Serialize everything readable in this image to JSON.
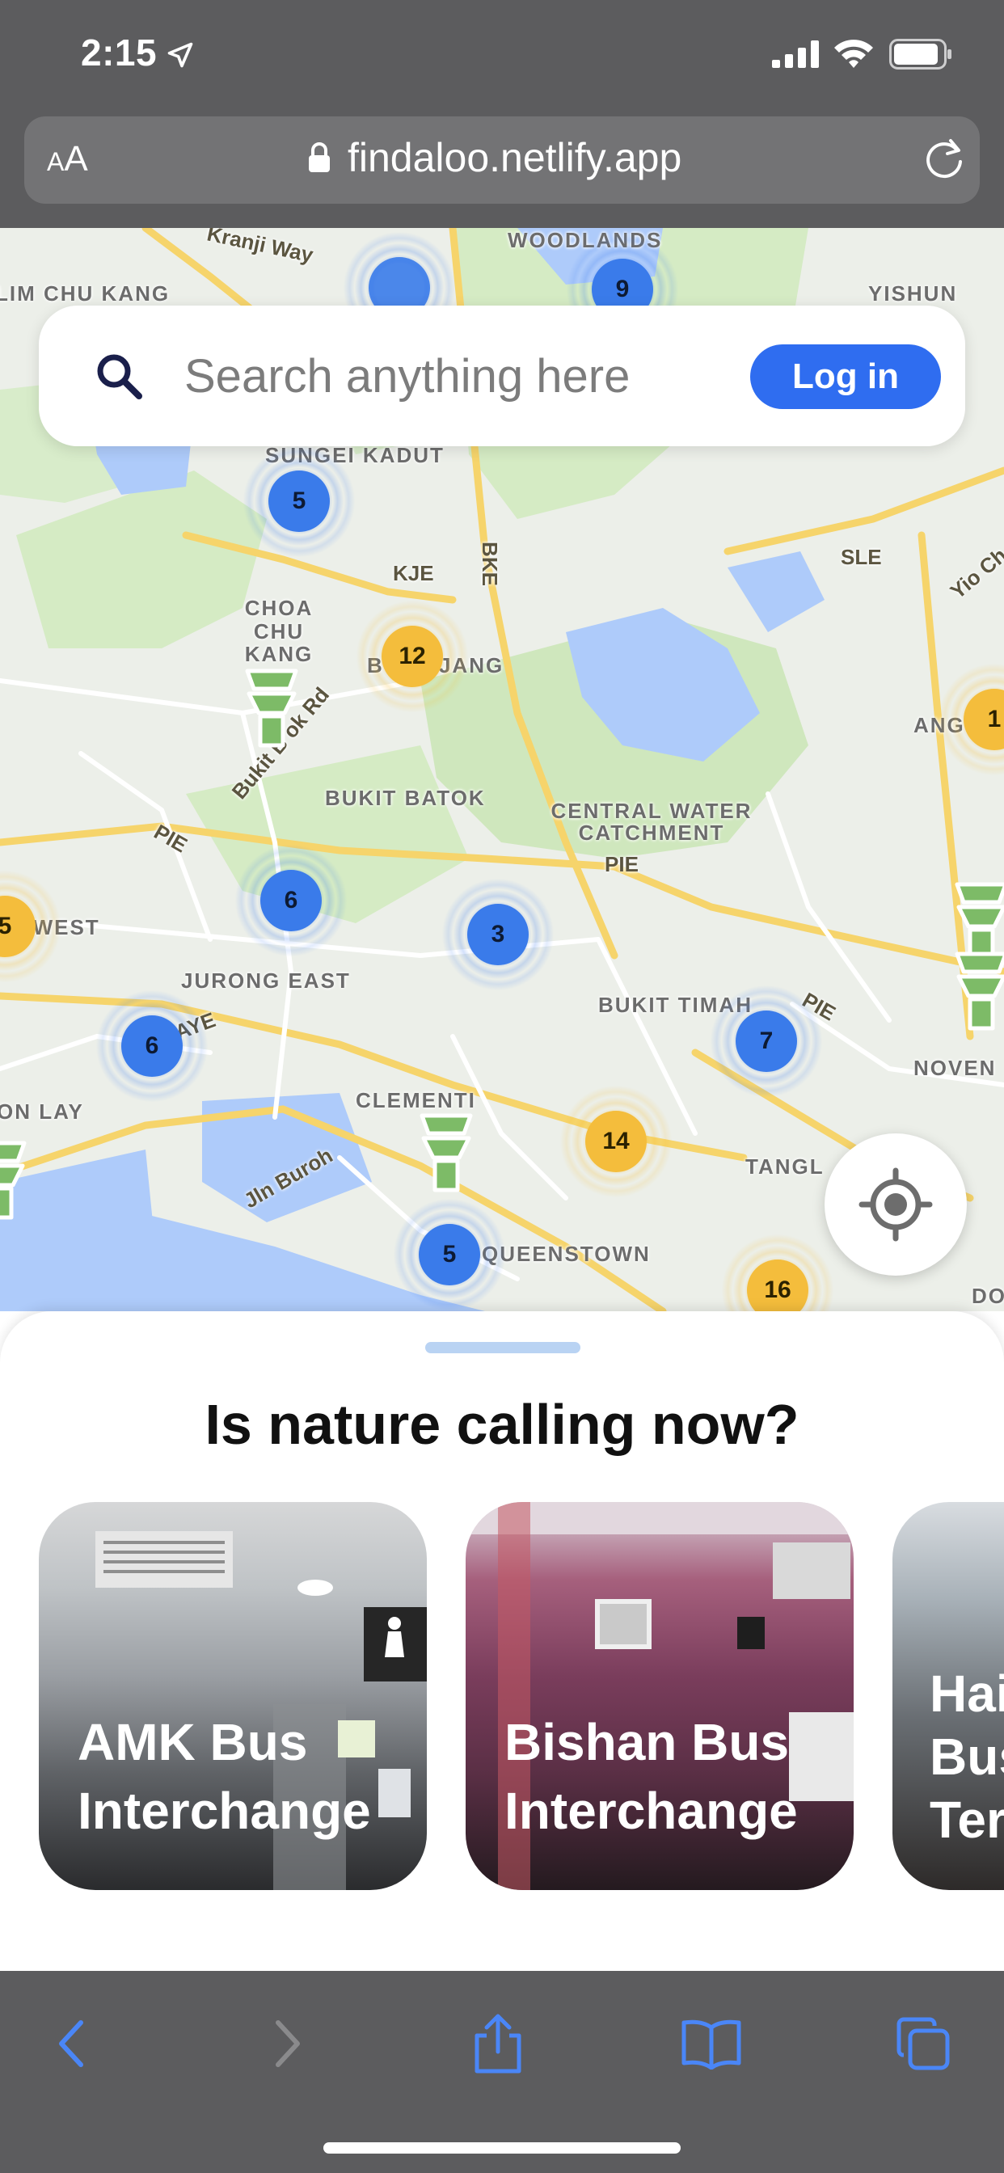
{
  "status_bar": {
    "time": "2:15",
    "icons": [
      "location-arrow-icon",
      "cellular-signal-icon",
      "wifi-icon",
      "battery-icon"
    ]
  },
  "browser": {
    "text_size_label_small": "A",
    "text_size_label_large": "A",
    "url": "findaloo.netlify.app",
    "icons": [
      "lock-icon",
      "reload-icon"
    ]
  },
  "map": {
    "labels": {
      "kranji_way": "Kranji Way",
      "woodlands": "WOODLANDS",
      "lim_chu_kang": "LIM CHU KANG",
      "yishun": "YISHUN",
      "sungei_kadut": "SUNGEI KADUT",
      "bke": "BKE",
      "kje": "KJE",
      "sle": "SLE",
      "yio_ch": "Yio Ch",
      "choa_chu_kang": "CHOA CHU KANG",
      "bukit_panjang": "B   PANJANG",
      "ang": "ANG",
      "bukit_batok_rd": "Bukit B   ok Rd",
      "bukit_batok": "BUKIT BATOK",
      "central_water_catchment": "CENTRAL WATER CATCHMENT",
      "pie_west": "PIE",
      "pie_mid": "PIE",
      "pie_east": "PIE",
      "west": "S WEST",
      "jurong_east": "JURONG EAST",
      "aye": "AYE",
      "bukit_timah": "BUKIT TIMAH",
      "noven": "NOVEN",
      "on_lay": "ON LAY",
      "clementi": "CLEMENTI",
      "jln_buroh": "Jln Buroh",
      "tangl": "TANGL",
      "queenstown": "QUEENSTOWN",
      "do": "DO"
    },
    "clusters": [
      "9",
      "5",
      "12",
      "1",
      "6",
      "3",
      "5",
      "6",
      "7",
      "14",
      "5",
      "16"
    ],
    "colors": {
      "blue_cluster": "#3a7bea",
      "yellow_cluster": "#f4bd3c",
      "toilet_marker": "#7dbb67"
    }
  },
  "search": {
    "placeholder": "Search anything here",
    "login_label": "Log in"
  },
  "sheet": {
    "title": "Is nature calling now?",
    "cards": [
      {
        "label": "AMK Bus\nInterchange"
      },
      {
        "label": "Bishan Bus\nInterchange"
      },
      {
        "label": "Hai\nBus\nTer"
      }
    ]
  },
  "toolbar": {
    "icons": [
      "back-icon",
      "forward-icon",
      "share-icon",
      "bookmarks-icon",
      "tabs-icon"
    ],
    "accent": "#4a86f7"
  }
}
